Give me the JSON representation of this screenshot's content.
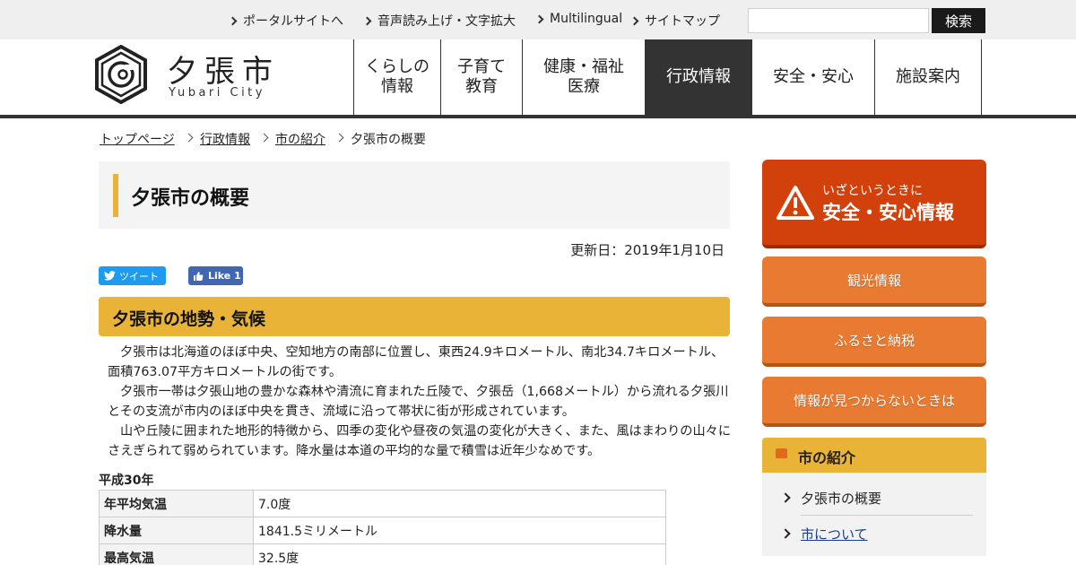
{
  "top_links": [
    "ポータルサイトへ",
    "音声読み上げ・文字拡大",
    "Multilingual",
    "サイトマップ"
  ],
  "search": {
    "placeholder": "",
    "button_label": "検索"
  },
  "logo": {
    "name_jp": "夕張市",
    "name_en": "Yubari City"
  },
  "global_nav": [
    {
      "line1": "くらしの",
      "line2": "情報"
    },
    {
      "line1": "子育て",
      "line2": "教育"
    },
    {
      "line1": "健康・福祉",
      "line2": "医療"
    },
    {
      "line1": "行政情報",
      "line2": ""
    },
    {
      "line1": "安全・安心",
      "line2": ""
    },
    {
      "line1": "施設案内",
      "line2": ""
    }
  ],
  "breadcrumb": [
    "トップページ",
    "行政情報",
    "市の紹介",
    "夕張市の概要"
  ],
  "page": {
    "title": "夕張市の概要",
    "updated": "更新日：2019年1月10日",
    "tweet_label": "ツイート",
    "like_label": "Like 1",
    "section_title": "夕張市の地勢・気候",
    "paragraphs": [
      "夕張市は北海道のほぼ中央、空知地方の南部に位置し、東西24.9キロメートル、南北34.7キロメートル、面積763.07平方キロメートルの街です。",
      "夕張市一帯は夕張山地の豊かな森林や清流に育まれた丘陵で、夕張岳（1,668メートル）から流れる夕張川とその支流が市内のほぼ中央を貫き、流域に沿って帯状に街が形成されています。",
      "山や丘陵に囲まれた地形的特徴から、四季の変化や昼夜の気温の変化が大きく、また、風はまわりの山々にさえぎられて弱められています。降水量は本道の平均的な量で積雪は近年少なめです。"
    ],
    "table_caption": "平成30年",
    "table_rows": [
      {
        "label": "年平均気温",
        "value": "7.0度"
      },
      {
        "label": "降水量",
        "value": "1841.5ミリメートル"
      },
      {
        "label": "最高気温",
        "value": "32.5度"
      }
    ]
  },
  "sidebar": {
    "emergency_sub": "いざというときに",
    "emergency_main": "安全・安心情報",
    "buttons": [
      "観光情報",
      "ふるさと納税",
      "情報が見つからないときは"
    ],
    "subnav_title": "市の紹介",
    "subnav_items": [
      "夕張市の概要",
      "市について"
    ]
  },
  "colors": {
    "accent_yellow": "#e8b337",
    "emergency_red": "#d2410b",
    "sidebar_orange": "#e87b31",
    "nav_active": "#333333"
  }
}
